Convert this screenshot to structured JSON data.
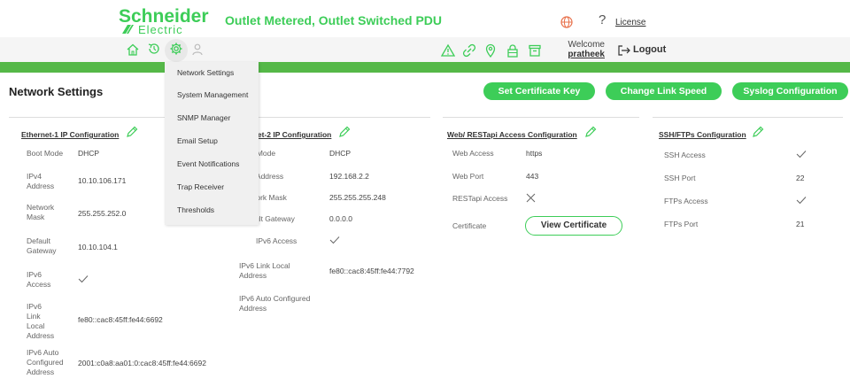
{
  "header": {
    "brand_main": "Schneider",
    "brand_sub": "Electric",
    "product": "Outlet Metered, Outlet Switched PDU",
    "help": "?",
    "license": "License",
    "welcome": "Welcome",
    "username": "pratheek",
    "logout": "Logout"
  },
  "menu": {
    "items": [
      "Network Settings",
      "System Management",
      "SNMP Manager",
      "Email Setup",
      "Event Notifications",
      "Trap Receiver",
      "Thresholds"
    ]
  },
  "page": {
    "title": "Network Settings",
    "buttons": [
      "Set Certificate Key",
      "Change Link Speed",
      "Syslog Configuration"
    ]
  },
  "eth1": {
    "title": "Ethernet-1 IP Configuration",
    "rows": [
      {
        "label": "Boot Mode",
        "value": "DHCP"
      },
      {
        "label": "IPv4 Address",
        "value": "10.10.106.171"
      },
      {
        "label": "Network Mask",
        "value": "255.255.252.0"
      },
      {
        "label": "Default Gateway",
        "value": "10.10.104.1"
      },
      {
        "label": "IPv6 Access",
        "value": "✓"
      },
      {
        "label": "IPv6 Link Local Address",
        "value": "fe80::cac8:45ff:fe44:6692"
      },
      {
        "label": "IPv6 Auto Configured Address",
        "value": "2001:c0a8:aa01:0:cac8:45ff:fe44:6692"
      }
    ]
  },
  "eth2": {
    "title": "Ethernet-2 IP Configuration",
    "rows": [
      {
        "label": "Boot Mode",
        "value": "DHCP"
      },
      {
        "label": "IPv4 Address",
        "value": "192.168.2.2"
      },
      {
        "label": "Network Mask",
        "value": "255.255.255.248"
      },
      {
        "label": "Default Gateway",
        "value": "0.0.0.0"
      },
      {
        "label": "IPv6 Access",
        "value": "✓"
      },
      {
        "label": "IPv6 Link Local Address",
        "value": "fe80::cac8:45ff:fe44:7792"
      },
      {
        "label": "IPv6 Auto Configured Address",
        "value": ""
      }
    ]
  },
  "web": {
    "title": "Web/ RESTapi Access Configuration",
    "rows": [
      {
        "label": "Web Access",
        "value": "https"
      },
      {
        "label": "Web Port",
        "value": "443"
      },
      {
        "label": "RESTapi Access",
        "value": "✕"
      },
      {
        "label": "Certificate",
        "value": ""
      }
    ],
    "view_certificate": "View Certificate"
  },
  "ssh": {
    "title": "SSH/FTPs Configuration",
    "rows": [
      {
        "label": "SSH Access",
        "value": "✓"
      },
      {
        "label": "SSH Port",
        "value": "22"
      },
      {
        "label": "FTPs Access",
        "value": "✓"
      },
      {
        "label": "FTPs Port",
        "value": "21"
      }
    ]
  },
  "colors": {
    "brand_green": "#3dcd58",
    "bar_green": "#55b848",
    "warning_orange": "#e8704a"
  }
}
